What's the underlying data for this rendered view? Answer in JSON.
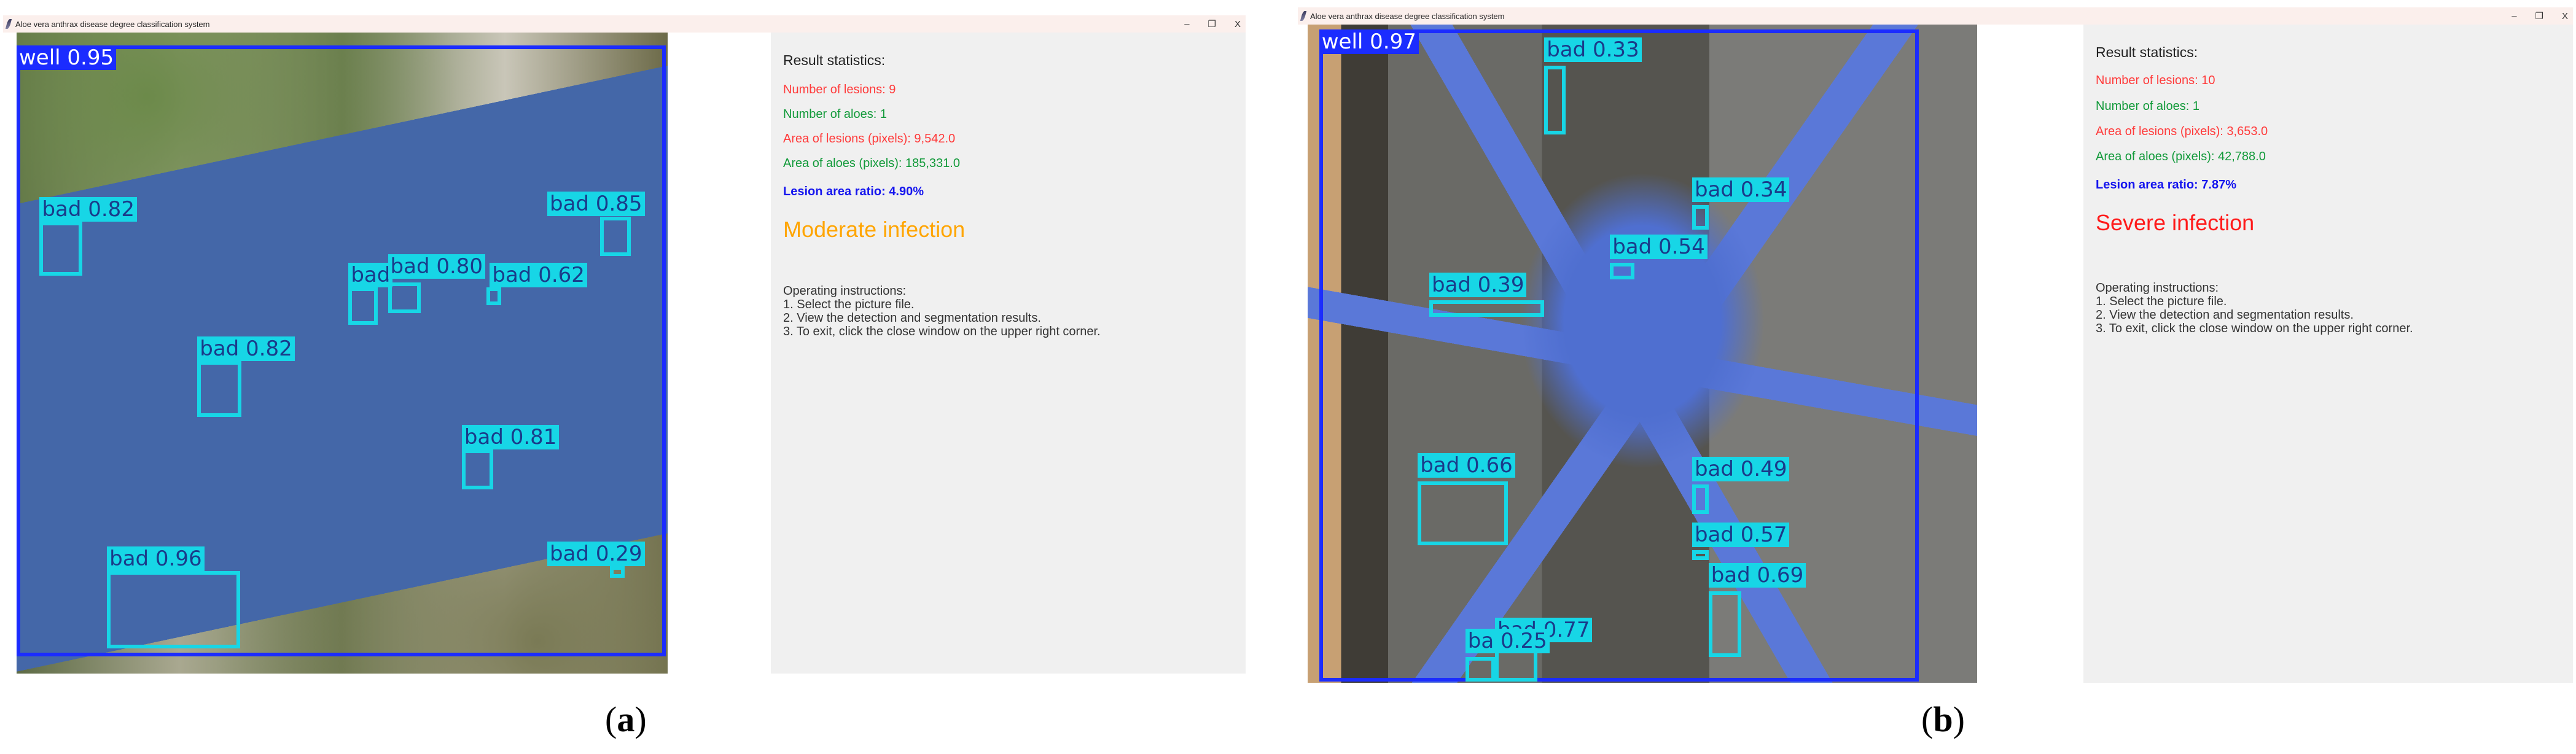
{
  "windows": [
    {
      "title": "Aloe vera anthrax disease degree classification system",
      "controls": {
        "minimize": "–",
        "restore": "❐",
        "close": "X"
      },
      "detections": [
        "well 0.95",
        "bad 0.82",
        "bad 0.85",
        "bad",
        "bad 0.80",
        "bad 0.62",
        "bad 0.82",
        "bad 0.81",
        "bad 0.29",
        "bad 0.96"
      ],
      "stats": {
        "heading": "Result statistics:",
        "lesions": "Number of lesions: 9",
        "aloes": "Number of aloes: 1",
        "lesion_area": "Area of lesions (pixels): 9,542.0",
        "aloe_area": "Area of aloes (pixels): 185,331.0",
        "ratio": "Lesion area ratio: 4.90%",
        "verdict": "Moderate infection",
        "verdict_color": "#ffa500"
      },
      "instructions": [
        "Operating instructions:",
        "1. Select the picture file.",
        "2. View the detection and segmentation results.",
        "3. To exit, click the close window on the upper right corner."
      ],
      "caption": {
        "open": "(",
        "letter": "a",
        "close": ")"
      }
    },
    {
      "title": "Aloe vera anthrax disease degree classification system",
      "controls": {
        "minimize": "–",
        "restore": "❐",
        "close": "X"
      },
      "detections": [
        "well 0.97",
        "bad 0.33",
        "bad 0.34",
        "bad 0.54",
        "bad 0.39",
        "bad 0.66",
        "bad 0.49",
        "bad 0.57",
        "bad 0.69",
        "bad 0.77",
        "ba 0.25"
      ],
      "stats": {
        "heading": "Result statistics:",
        "lesions": "Number of lesions: 10",
        "aloes": "Number of aloes: 1",
        "lesion_area": "Area of lesions (pixels): 3,653.0",
        "aloe_area": "Area of aloes (pixels): 42,788.0",
        "ratio": "Lesion area ratio: 7.87%",
        "verdict": "Severe infection",
        "verdict_color": "#ff1a1a"
      },
      "instructions": [
        "Operating instructions:",
        "1. Select the picture file.",
        "2. View the detection and segmentation results.",
        "3. To exit, click the close window on the upper right corner."
      ],
      "caption": {
        "open": "(",
        "letter": "b",
        "close": ")"
      }
    }
  ],
  "colors": {
    "lesion_text": "#ff3b3b",
    "aloe_text": "#129a3a",
    "ratio_text": "#1515ee",
    "bad_box": "#17d6e6",
    "well_box": "#1b2cff"
  }
}
